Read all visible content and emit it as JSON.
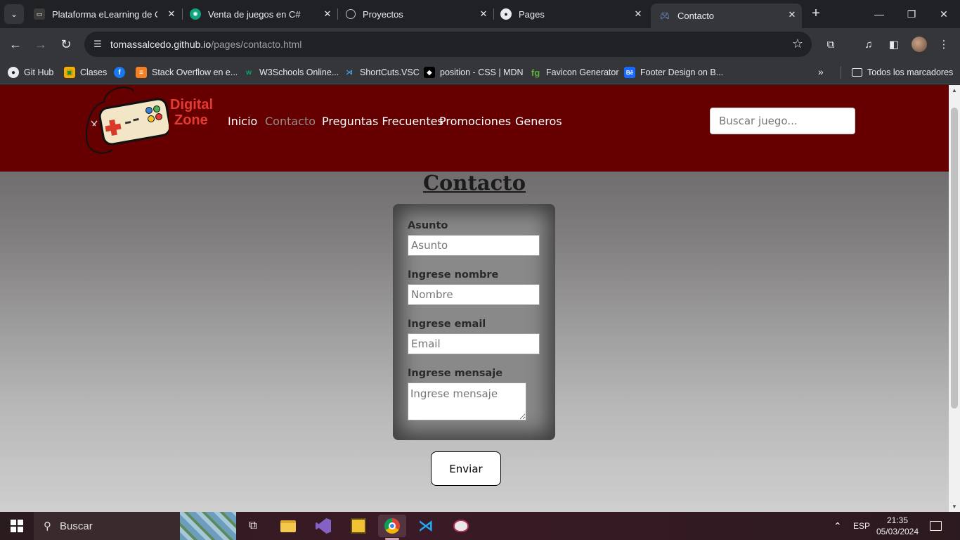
{
  "browser": {
    "tabs": [
      {
        "title": "Plataforma eLearning de Cod",
        "favicon": "codigo-facilito-icon"
      },
      {
        "title": "Venta de juegos en C#",
        "favicon": "chatgpt-icon"
      },
      {
        "title": "Proyectos",
        "favicon": "globe-icon"
      },
      {
        "title": "Pages",
        "favicon": "github-icon"
      },
      {
        "title": "Contacto",
        "favicon": "gamepad-icon"
      }
    ],
    "url_domain": "tomassalcedo.github.io",
    "url_path": "/pages/contacto.html",
    "bookmarks": [
      {
        "label": "Git Hub",
        "icon": "github-icon"
      },
      {
        "label": "Clases",
        "icon": "classroom-icon"
      },
      {
        "label": "",
        "icon": "facebook-icon"
      },
      {
        "label": "Stack Overflow en e...",
        "icon": "stackoverflow-icon"
      },
      {
        "label": "W3Schools Online...",
        "icon": "w3schools-icon"
      },
      {
        "label": "ShortCuts.VSC",
        "icon": "vscode-icon"
      },
      {
        "label": "position - CSS | MDN",
        "icon": "mdn-icon"
      },
      {
        "label": "Favicon Generator",
        "icon": "favicon-generator-icon"
      },
      {
        "label": "Footer Design on B...",
        "icon": "behance-icon"
      }
    ],
    "all_bookmarks_label": "Todos los marcadores"
  },
  "site": {
    "logo_line1": "Digital",
    "logo_line2": "Zone",
    "nav": [
      "Inicio",
      "Contacto",
      "Preguntas Frecuentes",
      "Promociones",
      "Generos"
    ],
    "search_placeholder": "Buscar juego..."
  },
  "page": {
    "title": "Contacto",
    "form": {
      "subject_label": "Asunto",
      "subject_placeholder": "Asunto",
      "name_label": "Ingrese nombre",
      "name_placeholder": "Nombre",
      "email_label": "Ingrese email",
      "email_placeholder": "Email",
      "message_label": "Ingrese mensaje",
      "message_placeholder": "Ingrese mensaje"
    },
    "submit_label": "Enviar"
  },
  "taskbar": {
    "search_label": "Buscar",
    "language": "ESP",
    "time": "21:35",
    "date": "05/03/2024"
  }
}
